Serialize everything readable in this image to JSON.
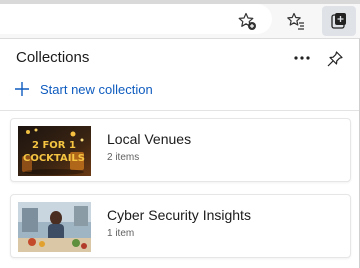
{
  "toolbar": {
    "favorite_icon": "star-plus-icon",
    "favorites_icon": "favorites-list-icon",
    "collections_icon": "collections-icon"
  },
  "panel": {
    "title": "Collections",
    "more_icon": "more-dots-icon",
    "pin_icon": "pin-icon",
    "new_collection_label": "Start new collection"
  },
  "collections": [
    {
      "title": "Local Venues",
      "count": "2 items",
      "thumb_text_line1": "2 FOR 1",
      "thumb_text_line2": "COCKTAILS"
    },
    {
      "title": "Cyber Security Insights",
      "count": "1 item"
    }
  ],
  "colors": {
    "accent": "#0f5cbf",
    "panel_border": "#cfcfcf",
    "toolbar_bg": "#f7f7f7"
  }
}
